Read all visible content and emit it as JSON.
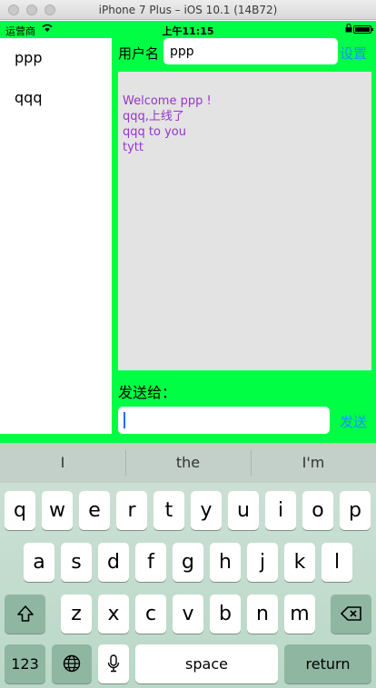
{
  "window": {
    "title": "iPhone 7 Plus – iOS 10.1 (14B72)"
  },
  "status_bar": {
    "carrier": "运营商",
    "time": "上午11:15"
  },
  "users": [
    "ppp",
    "qqq"
  ],
  "header": {
    "name_label": "用户名",
    "name_value": "ppp",
    "settings_label": "设置"
  },
  "chat": {
    "messages": [
      "Welcome ppp !",
      "qqq,上线了",
      "qqq to you",
      "tytt"
    ]
  },
  "compose": {
    "send_to_label": "发送给：",
    "message_value": "",
    "send_label": "发送"
  },
  "keyboard": {
    "suggestions": [
      "I",
      "the",
      "I'm"
    ],
    "row1": [
      "q",
      "w",
      "e",
      "r",
      "t",
      "y",
      "u",
      "i",
      "o",
      "p"
    ],
    "row2": [
      "a",
      "s",
      "d",
      "f",
      "g",
      "h",
      "j",
      "k",
      "l"
    ],
    "row3": [
      "z",
      "x",
      "c",
      "v",
      "b",
      "n",
      "m"
    ],
    "numbers_label": "123",
    "space_label": "space",
    "return_label": "return"
  },
  "colors": {
    "screen_bg": "#00ff44",
    "chat_text": "#9933cc",
    "link": "#1e90ff"
  }
}
